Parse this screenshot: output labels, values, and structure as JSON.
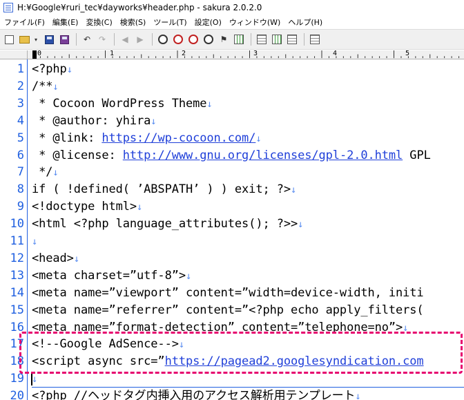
{
  "window": {
    "title": "H:¥Google¥ruri_tec¥dayworks¥header.php - sakura 2.0.2.0"
  },
  "menu": [
    {
      "label": "ファイル(F)"
    },
    {
      "label": "編集(E)"
    },
    {
      "label": "変換(C)"
    },
    {
      "label": "検索(S)"
    },
    {
      "label": "ツール(T)"
    },
    {
      "label": "設定(O)"
    },
    {
      "label": "ウィンドウ(W)"
    },
    {
      "label": "ヘルプ(H)"
    }
  ],
  "toolbar": {
    "icons": [
      "new-file-icon",
      "open-folder-icon",
      "dropdown-arrow-icon",
      "save-icon",
      "save-all-icon",
      "undo-icon",
      "redo-icon",
      "jump-back-icon",
      "jump-forward-icon",
      "find-icon",
      "find-prev-icon",
      "find-next-icon",
      "replace-icon",
      "bookmark-icon",
      "grep-icon",
      "outline-icon",
      "compare-icon",
      "tag-jump-icon",
      "settings-icon"
    ],
    "glyphs": {
      "dropdown": "▾",
      "undo": "↶",
      "redo": "↷",
      "jump_back": "◀",
      "jump_forward": "▶",
      "bookmark": "⚑"
    }
  },
  "ruler": {
    "labels": [
      {
        "text": "0"
      },
      {
        "text": "1"
      },
      {
        "text": "2"
      },
      {
        "text": "3"
      },
      {
        "text": "4"
      },
      {
        "text": "5"
      }
    ]
  },
  "editor": {
    "eol_glyph": "↓",
    "lines": [
      {
        "num": "1",
        "parts": [
          {
            "t": "<?php"
          }
        ],
        "eol": true
      },
      {
        "num": "2",
        "parts": [
          {
            "t": "/**"
          }
        ],
        "eol": true
      },
      {
        "num": "3",
        "parts": [
          {
            "t": " * Cocoon WordPress Theme"
          }
        ],
        "eol": true
      },
      {
        "num": "4",
        "parts": [
          {
            "t": " * @author: yhira"
          }
        ],
        "eol": true
      },
      {
        "num": "5",
        "parts": [
          {
            "t": " * @link: "
          },
          {
            "t": "https://wp-cocoon.com/",
            "link": true
          }
        ],
        "eol": true
      },
      {
        "num": "6",
        "parts": [
          {
            "t": " * @license: "
          },
          {
            "t": "http://www.gnu.org/licenses/gpl-2.0.html",
            "link": true
          },
          {
            "t": " GPL"
          }
        ],
        "eol": false
      },
      {
        "num": "7",
        "parts": [
          {
            "t": " */"
          }
        ],
        "eol": true
      },
      {
        "num": "8",
        "parts": [
          {
            "t": "if ( !defined( ’ABSPATH’ ) ) exit; ?>"
          }
        ],
        "eol": true
      },
      {
        "num": "9",
        "parts": [
          {
            "t": "<!doctype html>"
          }
        ],
        "eol": true
      },
      {
        "num": "10",
        "parts": [
          {
            "t": "<html <?php language_attributes(); ?>>"
          }
        ],
        "eol": true
      },
      {
        "num": "11",
        "parts": [
          {
            "t": ""
          }
        ],
        "eol": true
      },
      {
        "num": "12",
        "parts": [
          {
            "t": "<head>"
          }
        ],
        "eol": true
      },
      {
        "num": "13",
        "parts": [
          {
            "t": "<meta charset=”utf-8”>"
          }
        ],
        "eol": true
      },
      {
        "num": "14",
        "parts": [
          {
            "t": "<meta name=”viewport” content=”width=device-width, initi"
          }
        ],
        "eol": false
      },
      {
        "num": "15",
        "parts": [
          {
            "t": "<meta name=”referrer” content=”<?php echo apply_filters("
          }
        ],
        "eol": false
      },
      {
        "num": "16",
        "parts": [
          {
            "t": "<meta name=”format-detection” content=”telephone=no”>"
          }
        ],
        "eol": true
      },
      {
        "num": "17",
        "parts": [
          {
            "t": "<!--Google AdSence-->"
          }
        ],
        "eol": true
      },
      {
        "num": "18",
        "parts": [
          {
            "t": "<script async src=”"
          },
          {
            "t": "https://pagead2.googlesyndication.com",
            "link": true
          }
        ],
        "eol": false
      },
      {
        "num": "19",
        "parts": [
          {
            "t": ""
          }
        ],
        "eol": true,
        "current": true
      },
      {
        "num": "20",
        "parts": [
          {
            "t": "<?php //ヘッドタグ内挿入用のアクセス解析用テンプレート"
          }
        ],
        "eol": true
      }
    ]
  },
  "highlight": {
    "color": "#e6006e",
    "lines": [
      "17",
      "18"
    ]
  }
}
